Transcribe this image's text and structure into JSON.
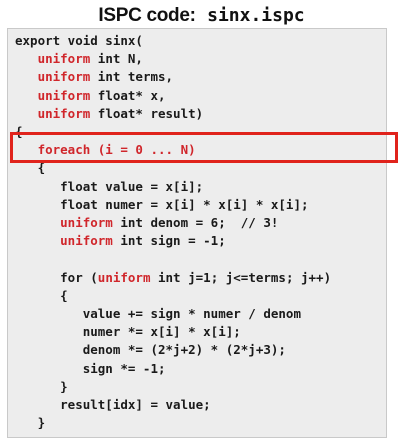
{
  "title": {
    "label": "ISPC code:",
    "filename": "sinx.ispc"
  },
  "colors": {
    "keyword": "#d0262b",
    "text": "#1a1a1a",
    "code_background": "#ededed",
    "highlight": "#e0231c"
  },
  "code": {
    "lines": [
      [
        {
          "t": "export void sinx(",
          "k": false
        }
      ],
      [
        {
          "t": "   ",
          "k": false
        },
        {
          "t": "uniform",
          "k": true
        },
        {
          "t": " int N,",
          "k": false
        }
      ],
      [
        {
          "t": "   ",
          "k": false
        },
        {
          "t": "uniform",
          "k": true
        },
        {
          "t": " int terms,",
          "k": false
        }
      ],
      [
        {
          "t": "   ",
          "k": false
        },
        {
          "t": "uniform",
          "k": true
        },
        {
          "t": " float* x,",
          "k": false
        }
      ],
      [
        {
          "t": "   ",
          "k": false
        },
        {
          "t": "uniform",
          "k": true
        },
        {
          "t": " float* result)",
          "k": false
        }
      ],
      [
        {
          "t": "{",
          "k": false
        }
      ],
      [
        {
          "t": "   ",
          "k": false
        },
        {
          "t": "foreach (i = 0 ... N)",
          "k": true
        }
      ],
      [
        {
          "t": "   {",
          "k": false
        }
      ],
      [
        {
          "t": "      float value = x[i];",
          "k": false
        }
      ],
      [
        {
          "t": "      float numer = x[i] * x[i] * x[i];",
          "k": false
        }
      ],
      [
        {
          "t": "      ",
          "k": false
        },
        {
          "t": "uniform",
          "k": true
        },
        {
          "t": " int denom = 6;  // 3!",
          "k": false
        }
      ],
      [
        {
          "t": "      ",
          "k": false
        },
        {
          "t": "uniform",
          "k": true
        },
        {
          "t": " int sign = -1;",
          "k": false
        }
      ],
      [
        {
          "t": "",
          "k": false
        }
      ],
      [
        {
          "t": "      for (",
          "k": false
        },
        {
          "t": "uniform",
          "k": true
        },
        {
          "t": " int j=1; j<=terms; j++)",
          "k": false
        }
      ],
      [
        {
          "t": "      {",
          "k": false
        }
      ],
      [
        {
          "t": "         value += sign * numer / denom",
          "k": false
        }
      ],
      [
        {
          "t": "         numer *= x[i] * x[i];",
          "k": false
        }
      ],
      [
        {
          "t": "         denom *= (2*j+2) * (2*j+3);",
          "k": false
        }
      ],
      [
        {
          "t": "         sign *= -1;",
          "k": false
        }
      ],
      [
        {
          "t": "      }",
          "k": false
        }
      ],
      [
        {
          "t": "      result[idx] = value;",
          "k": false
        }
      ],
      [
        {
          "t": "   }",
          "k": false
        }
      ]
    ]
  }
}
